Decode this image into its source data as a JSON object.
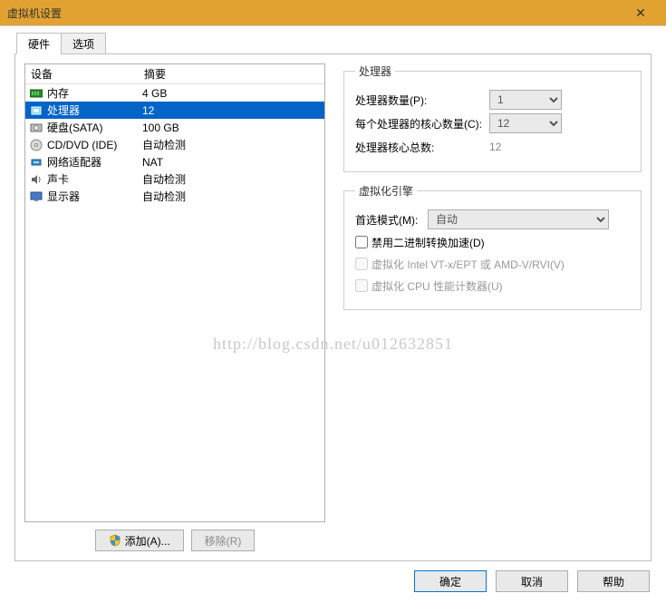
{
  "window": {
    "title": "虚拟机设置",
    "close": "✕"
  },
  "tabs": {
    "hardware": "硬件",
    "options": "选项"
  },
  "list": {
    "header_device": "设备",
    "header_summary": "摘要",
    "rows": [
      {
        "name": "内存",
        "summary": "4 GB",
        "icon": "memory"
      },
      {
        "name": "处理器",
        "summary": "12",
        "icon": "cpu",
        "selected": true
      },
      {
        "name": "硬盘(SATA)",
        "summary": "100 GB",
        "icon": "disk"
      },
      {
        "name": "CD/DVD (IDE)",
        "summary": "自动检测",
        "icon": "cd"
      },
      {
        "name": "网络适配器",
        "summary": "NAT",
        "icon": "network"
      },
      {
        "name": "声卡",
        "summary": "自动检测",
        "icon": "sound"
      },
      {
        "name": "显示器",
        "summary": "自动检测",
        "icon": "display"
      }
    ]
  },
  "buttons": {
    "add": "添加(A)...",
    "remove": "移除(R)"
  },
  "processors": {
    "legend": "处理器",
    "count_label": "处理器数量(P):",
    "count_value": "1",
    "cores_label": "每个处理器的核心数量(C):",
    "cores_value": "12",
    "total_label": "处理器核心总数:",
    "total_value": "12"
  },
  "virt_engine": {
    "legend": "虚拟化引擎",
    "mode_label": "首选模式(M):",
    "mode_value": "自动",
    "disable_binary": "禁用二进制转换加速(D)",
    "vtx": "虚拟化 Intel VT-x/EPT 或 AMD-V/RVI(V)",
    "cpu_counters": "虚拟化 CPU 性能计数器(U)"
  },
  "dialog_buttons": {
    "ok": "确定",
    "cancel": "取消",
    "help": "帮助"
  },
  "watermark": "http://blog.csdn.net/u012632851"
}
